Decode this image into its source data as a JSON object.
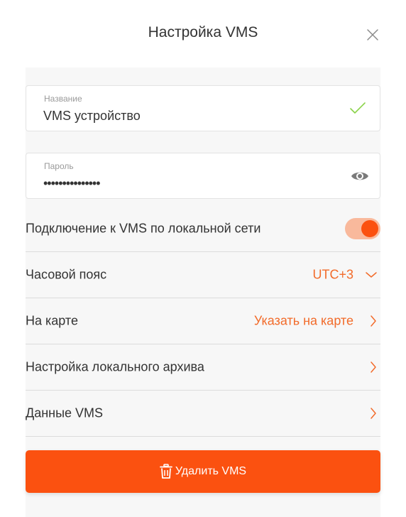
{
  "dialog": {
    "title": "Настройка VMS"
  },
  "fields": {
    "name": {
      "label": "Название",
      "value": "VMS устройство"
    },
    "password": {
      "label": "Пароль",
      "value": "•••••••••••••••"
    }
  },
  "rows": {
    "local_network": {
      "label": "Подключение к VMS по локальной сети",
      "enabled": true
    },
    "timezone": {
      "label": "Часовой пояс",
      "value": "UTC+3"
    },
    "map": {
      "label": "На карте",
      "value": "Указать на карте"
    },
    "archive": {
      "label": "Настройка локального архива"
    },
    "vms_data": {
      "label": "Данные VMS"
    }
  },
  "actions": {
    "delete_label": "Удалить VMS"
  },
  "icons": {
    "close": "close-icon",
    "check": "check-icon",
    "eye": "eye-icon",
    "chevron_down": "chevron-down-icon",
    "chevron_right": "chevron-right-icon",
    "trash": "trash-icon"
  },
  "colors": {
    "accent": "#fb5110",
    "accent_text": "#f26b2a",
    "toggle_track": "#f9b99c",
    "check": "#8bd34a",
    "panel_background": "#f7f7f7"
  }
}
